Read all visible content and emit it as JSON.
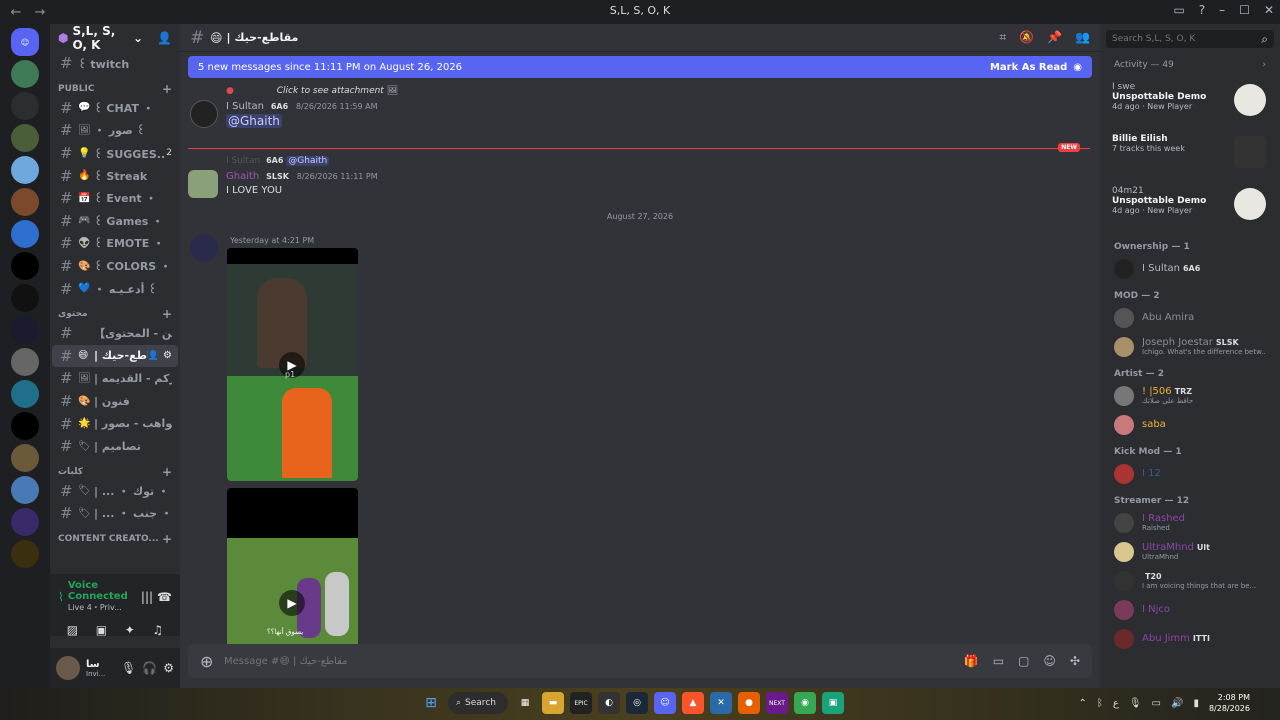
{
  "window": {
    "title": "S,L, S, O, K",
    "back": "←",
    "forward": "→"
  },
  "server": {
    "name": "S,L, S, O, K"
  },
  "channels": {
    "top": [
      {
        "label": "꒰ twitch"
      }
    ],
    "categories": [
      {
        "label": "PUBLIC",
        "items": [
          {
            "emoji": "💬",
            "label": "꒰ CHAT ・"
          },
          {
            "emoji": "🖼",
            "label": "・ صور ꒰"
          },
          {
            "emoji": "💡",
            "label": "꒰ SUGGES...",
            "count": "2"
          },
          {
            "emoji": "🔥",
            "label": "꒰ Streak"
          },
          {
            "emoji": "📅",
            "label": "꒰ Event ・"
          },
          {
            "emoji": "🎮",
            "label": "꒰ Games ・"
          },
          {
            "emoji": "👽",
            "label": "꒰ EMOTE ・"
          },
          {
            "emoji": "🎨",
            "label": "꒰ COLORS ・"
          },
          {
            "emoji": "💙",
            "label": "・ أدعـيـه ꒰"
          }
        ]
      },
      {
        "label": "محتوى",
        "items": [
          {
            "emoji": "",
            "label": "【قوانين - المحتوى】"
          },
          {
            "emoji": "😄",
            "label": "| مقاطع-حيك",
            "active": true
          },
          {
            "emoji": "🖼",
            "label": "| صوركم - القديمه"
          },
          {
            "emoji": "🎨",
            "label": "| فنون"
          },
          {
            "emoji": "🌟",
            "label": "| مواهب - بصور..."
          },
          {
            "emoji": "🏷",
            "label": "| تصاميم"
          }
        ]
      },
      {
        "label": "كلبات",
        "items": [
          {
            "emoji": "🏷",
            "label": "| ... ・ للتيك ・ توك"
          },
          {
            "emoji": "🏷",
            "label": "| ... ・ على ・ جنب"
          }
        ]
      },
      {
        "label": "CONTENT CREATO...",
        "items": []
      }
    ]
  },
  "voice": {
    "title": "Voice Connected",
    "subtitle": "Live 4・Priv..."
  },
  "user": {
    "name": "سا",
    "status": "Invi..."
  },
  "chat": {
    "channel_emoji": "😄",
    "channel_title": "| مقاطع-حيك",
    "banner_text": "5 new messages since 11:11 PM on August 26, 2026",
    "banner_action": "Mark As Read",
    "messages": [
      {
        "reply_text": "Click to see attachment",
        "author": "I Sultan",
        "badge": "6A6",
        "time": "8/26/2026 11:59 AM",
        "text": "@Ghaith"
      },
      {
        "reply_author": "I Sultan",
        "reply_badge": "6A6",
        "reply_text": "@Ghaith",
        "author": "Ghaith",
        "badge": "SLSK",
        "time": "8/26/2026 11:11 PM",
        "text": "I LOVE YOU"
      },
      {
        "author": "",
        "time": "Yesterday at 4:21 PM"
      }
    ],
    "new_label": "NEW",
    "date_separator": "August 27, 2026",
    "video1_overlay": "p1",
    "video2_caption": "يسوق أنها؟؟",
    "composer_placeholder": "Message #😄 | مقاطع-حيك"
  },
  "members": {
    "search_placeholder": "Search S,L, S, O, K",
    "activity_label": "Activity — 49",
    "activities": [
      {
        "user": "I swe",
        "title": "Unspottable Demo",
        "sub": "4d ago · New Player"
      },
      {
        "user": "",
        "title": "Billie Eilish",
        "sub": "7 tracks this week"
      },
      {
        "user": "04m21",
        "title": "Unspottable Demo",
        "sub": "4d ago · New Player"
      }
    ],
    "groups": [
      {
        "role": "Ownership — 1",
        "members": [
          {
            "name": "I Sultan",
            "badge": "6A6",
            "color": "#b5bac1",
            "sub": ""
          }
        ]
      },
      {
        "role": "MOD — 2",
        "members": [
          {
            "name": "Abu Amira",
            "badge": "",
            "color": "#8a8f96",
            "sub": ""
          },
          {
            "name": "Joseph Joestar",
            "badge": "SLSK",
            "color": "#8a8f96",
            "sub": "Ichigo. What's the difference betw..."
          }
        ]
      },
      {
        "role": "Artist — 2",
        "members": [
          {
            "name": "! |506",
            "badge": "TRZ",
            "color": "#f0b232",
            "sub": "حافظ على صلاتك"
          },
          {
            "name": "saba",
            "badge": "",
            "color": "#f0b232",
            "sub": ""
          }
        ]
      },
      {
        "role": "Kick Mod — 1",
        "members": [
          {
            "name": "I 12",
            "badge": "",
            "color": "#3b5998",
            "sub": ""
          }
        ]
      },
      {
        "role": "Streamer — 12",
        "members": [
          {
            "name": "I Rashed",
            "badge": "",
            "color": "#8e44ad",
            "sub": "Raished"
          },
          {
            "name": "UltraMhnd",
            "badge": "Ult",
            "color": "#8e44ad",
            "sub": "UltraMhnd"
          },
          {
            "name": "",
            "badge": "T20",
            "color": "#8e44ad",
            "sub": "I am voicing things that are be..."
          },
          {
            "name": "I Njco",
            "badge": "",
            "color": "#8e44ad",
            "sub": ""
          },
          {
            "name": "Abu Jimm",
            "badge": "ITTI",
            "color": "#8e44ad",
            "sub": ""
          }
        ]
      }
    ]
  },
  "taskbar": {
    "search_label": "Search",
    "time": "2:08 PM",
    "date": "8/28/2026"
  }
}
